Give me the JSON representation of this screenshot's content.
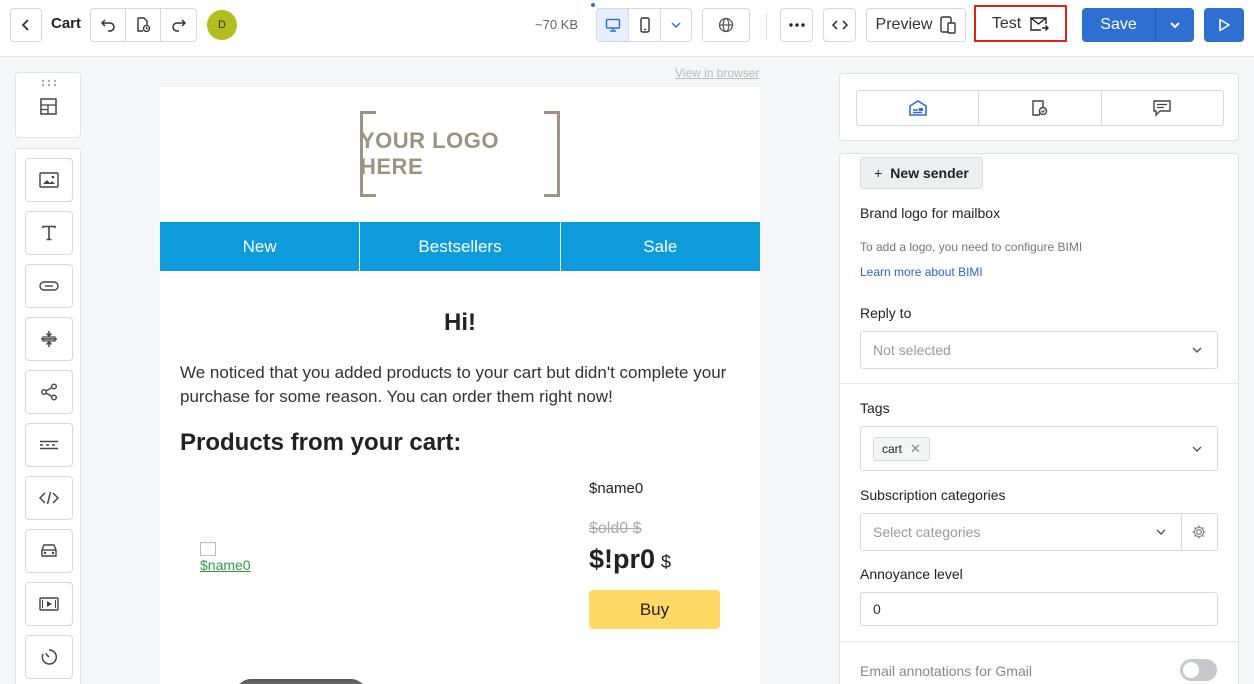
{
  "header": {
    "title": "Cart",
    "avatar_initial": "D",
    "size": "~70 KB",
    "preview_label": "Preview",
    "test_label": "Test",
    "save_label": "Save"
  },
  "canvas": {
    "view_in_browser": "View in browser",
    "logo_text": "YOUR LOGO HERE",
    "nav": [
      "New",
      "Bestsellers",
      "Sale"
    ],
    "greeting": "Hi!",
    "intro": "We noticed that you added products to your cart but didn't complete your purchase for some reason. You can order them right now!",
    "products_title": "Products from your cart:",
    "product": {
      "image_alt": "$name0",
      "name": "$name0",
      "old_price": "$old0 $",
      "price": "$!pr0",
      "currency": "$",
      "buy_label": "Buy"
    }
  },
  "settings": {
    "new_sender": "New sender",
    "brand_logo_label": "Brand logo for mailbox",
    "brand_logo_hint": "To add a logo, you need to configure BIMI",
    "bimi_link": "Learn more about BIMI",
    "reply_to_label": "Reply to",
    "reply_to_value": "Not selected",
    "tags_label": "Tags",
    "tags": [
      "cart"
    ],
    "subscription_label": "Subscription categories",
    "subscription_placeholder": "Select categories",
    "annoyance_label": "Annoyance level",
    "annoyance_value": "0",
    "gmail_label": "Email annotations for Gmail"
  },
  "colors": {
    "accent": "#2e6fd1",
    "nav_bg": "#0e9bdc",
    "buy_bg": "#ffd966",
    "highlight": "#e0201b"
  }
}
